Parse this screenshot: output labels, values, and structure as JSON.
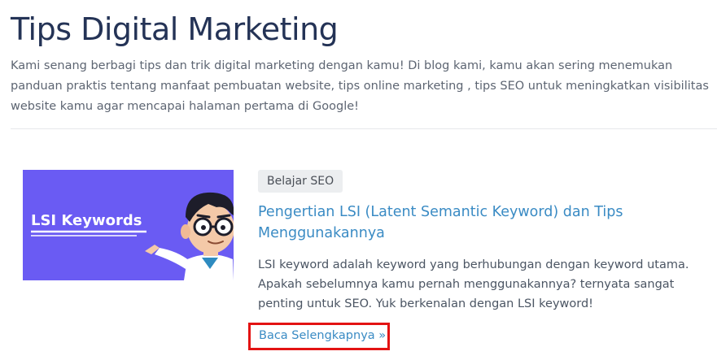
{
  "header": {
    "title": "Tips Digital Marketing",
    "intro": "Kami senang berbagi tips dan trik digital marketing dengan kamu! Di blog kami, kamu akan sering menemukan panduan praktis tentang manfaat pembuatan website, tips online marketing , tips SEO untuk meningkatkan visibilitas website kamu agar mencapai halaman pertama di Google!"
  },
  "post": {
    "category": "Belajar SEO",
    "title": "Pengertian LSI (Latent Semantic Keyword) dan Tips Menggunakannya",
    "excerpt": "LSI keyword adalah keyword yang berhubungan dengan keyword utama. Apakah sebelumnya kamu pernah menggunakannya? ternyata sangat penting untuk SEO. Yuk berkenalan dengan LSI keyword!",
    "read_more": "Baca Selengkapnya »",
    "thumbnail": {
      "text": "LSI Keywords",
      "background_color": "#6a5bf3"
    }
  },
  "colors": {
    "title": "#243356",
    "link": "#3a8bc4",
    "highlight_box": "#e31313"
  }
}
